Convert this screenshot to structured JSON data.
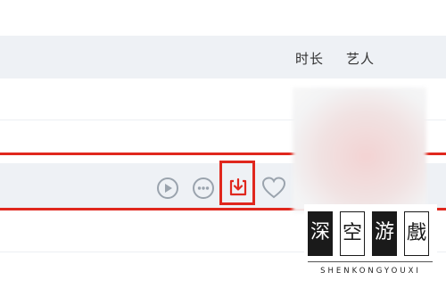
{
  "table_header": {
    "duration_label": "时长",
    "artist_label": "艺人"
  },
  "song_row_actions": {
    "play_icon": "play-circle-icon",
    "more_icon": "more-dots-icon",
    "download_icon": "download-icon",
    "like_icon": "heart-icon"
  },
  "watermark": {
    "chars": [
      "深",
      "空",
      "游",
      "戲"
    ],
    "subtitle": "SHENKONGYOUXI"
  },
  "colors": {
    "highlight_red": "#e0271d",
    "header_bg": "#eef1f5",
    "icon_gray": "#9aa3ad"
  }
}
